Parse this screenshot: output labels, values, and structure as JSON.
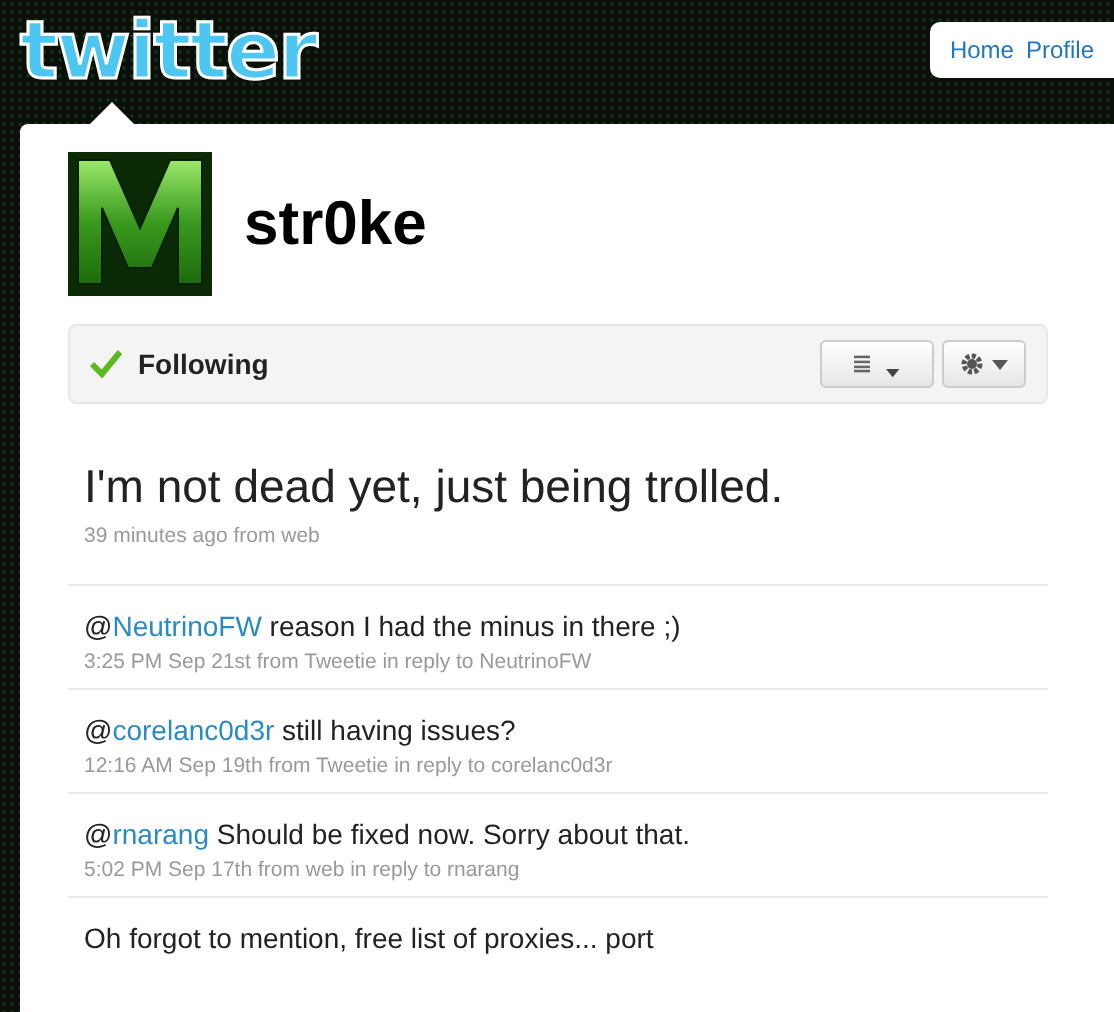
{
  "logo": {
    "text": "twitter"
  },
  "nav": [
    {
      "label": "Home"
    },
    {
      "label": "Profile"
    }
  ],
  "profile": {
    "screen_name": "str0ke"
  },
  "actions": {
    "following": true,
    "following_label": "Following"
  },
  "latest": {
    "text": "I'm not dead yet, just being trolled.",
    "meta": "39 minutes ago from web"
  },
  "tweets": [
    {
      "prefix": "@",
      "mention": "NeutrinoFW",
      "text": "reason I had the minus in there ;)",
      "meta": "3:25 PM Sep 21st from Tweetie in reply to NeutrinoFW"
    },
    {
      "prefix": "@",
      "mention": "corelanc0d3r",
      "text": "still having issues?",
      "meta": "12:16 AM Sep 19th from Tweetie in reply to corelanc0d3r"
    },
    {
      "prefix": "@",
      "mention": "rnarang",
      "text": "Should be fixed now. Sorry about that.",
      "meta": "5:02 PM Sep 17th from web in reply to rnarang"
    },
    {
      "text": "Oh forgot to mention, free list of proxies... port"
    }
  ]
}
